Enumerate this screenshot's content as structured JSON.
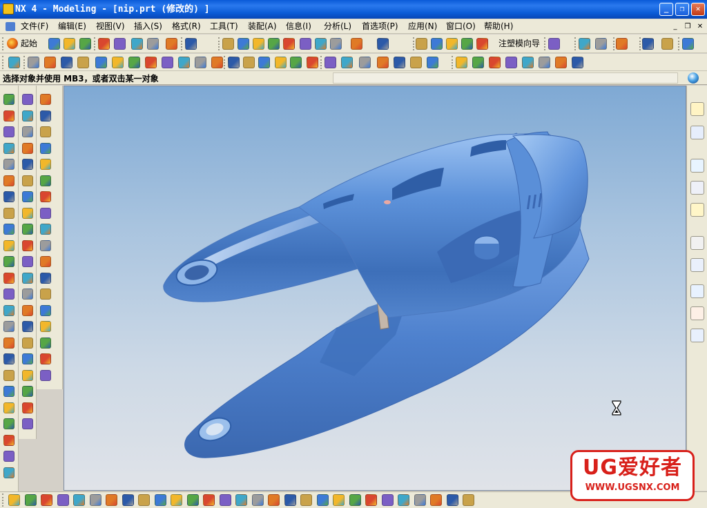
{
  "window": {
    "title": "NX 4 - Modeling - [nip.prt  (修改的) ]",
    "buttons": {
      "minimize": "_",
      "restore": "❐",
      "close": "✕"
    }
  },
  "menu": {
    "items": [
      "文件(F)",
      "编辑(E)",
      "视图(V)",
      "插入(S)",
      "格式(R)",
      "工具(T)",
      "装配(A)",
      "信息(I)",
      "分析(L)",
      "首选项(P)",
      "应用(N)",
      "窗口(O)",
      "帮助(H)"
    ],
    "mdi_buttons": [
      "_",
      "❐",
      "✕"
    ]
  },
  "toolbar": {
    "start_label": "起始",
    "mold_wizard_label": "注塑模向导"
  },
  "status": {
    "prompt": "选择对象并使用 MB3，或者双击某一对象"
  },
  "watermark": {
    "title": "UG爱好者",
    "url": "WWW.UGSNX.COM"
  },
  "colors": {
    "titlebar": "#0a5ad8",
    "model": "#5a90d8",
    "viewport_top": "#7fa9d4",
    "viewport_bottom": "#e0e3e8",
    "watermark": "#d8201a"
  },
  "icons": {
    "titlebar": "nx-app-icon",
    "cursor": "hourglass-icon"
  }
}
